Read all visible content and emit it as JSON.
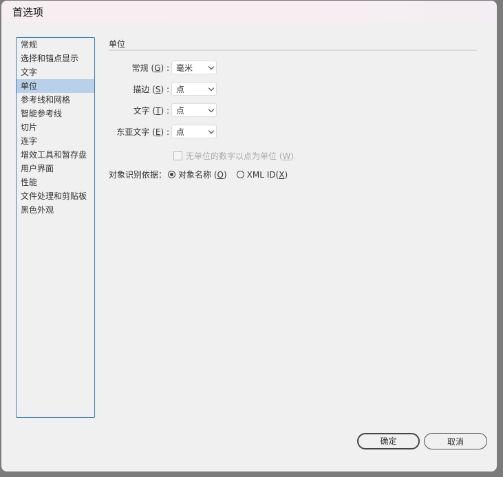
{
  "window": {
    "title": "首选项"
  },
  "sidebar": {
    "items": [
      {
        "label": "常规"
      },
      {
        "label": "选择和锚点显示"
      },
      {
        "label": "文字"
      },
      {
        "label": "单位",
        "selected": true
      },
      {
        "label": "参考线和网格"
      },
      {
        "label": "智能参考线"
      },
      {
        "label": "切片"
      },
      {
        "label": "连字"
      },
      {
        "label": "增效工具和暂存盘"
      },
      {
        "label": "用户界面"
      },
      {
        "label": "性能"
      },
      {
        "label": "文件处理和剪贴板"
      },
      {
        "label": "黑色外观"
      }
    ]
  },
  "section": {
    "title": "单位"
  },
  "fields": [
    {
      "label": "常规",
      "key": "G",
      "value": "毫米"
    },
    {
      "label": "描边",
      "key": "S",
      "value": "点"
    },
    {
      "label": "文字",
      "key": "T",
      "value": "点"
    },
    {
      "label": "东亚文字",
      "key": "E",
      "value": "点"
    }
  ],
  "checkbox": {
    "label": "无单位的数字以点为单位",
    "key": "W",
    "checked": false,
    "disabled": true
  },
  "identify": {
    "label": "对象识别依据：",
    "options": [
      {
        "label": "对象名称",
        "key": "O",
        "selected": true
      },
      {
        "label": "XML ID",
        "key": "X",
        "selected": false
      }
    ]
  },
  "buttons": {
    "ok": "确定",
    "cancel": "取消"
  }
}
